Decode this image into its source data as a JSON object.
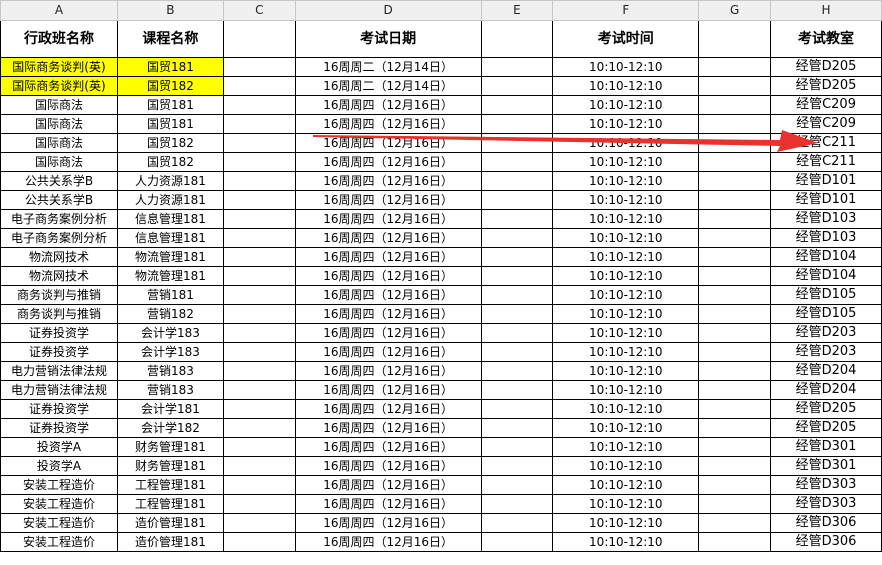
{
  "column_letters": [
    "A",
    "B",
    "C",
    "D",
    "E",
    "F",
    "G",
    "H"
  ],
  "headers": {
    "class": "行政班名称",
    "course": "课程名称",
    "c": "",
    "date": "考试日期",
    "e": "",
    "time": "考试时间",
    "g": "",
    "room": "考试教室"
  },
  "highlight_color": "#ffff00",
  "arrow": {
    "color": "#e8322d",
    "description_icon": "red-arrow-icon"
  },
  "rows": [
    {
      "a": "国际商务谈判(英)",
      "b": "国贸181",
      "d": "16周周二（12月14日）",
      "f": "10:10-12:10",
      "h": "经管D205",
      "highlight": true
    },
    {
      "a": "国际商务谈判(英)",
      "b": "国贸182",
      "d": "16周周二（12月14日）",
      "f": "10:10-12:10",
      "h": "经管D205",
      "highlight": true
    },
    {
      "a": "国际商法",
      "b": "国贸181",
      "d": "16周周四（12月16日）",
      "f": "10:10-12:10",
      "h": "经管C209"
    },
    {
      "a": "国际商法",
      "b": "国贸181",
      "d": "16周周四（12月16日）",
      "f": "10:10-12:10",
      "h": "经管C209"
    },
    {
      "a": "国际商法",
      "b": "国贸182",
      "d": "16周周四（12月16日）",
      "f": "10:10-12:10",
      "h": "经管C211"
    },
    {
      "a": "国际商法",
      "b": "国贸182",
      "d": "16周周四（12月16日）",
      "f": "10:10-12:10",
      "h": "经管C211"
    },
    {
      "a": "公共关系学B",
      "b": "人力资源181",
      "d": "16周周四（12月16日）",
      "f": "10:10-12:10",
      "h": "经管D101"
    },
    {
      "a": "公共关系学B",
      "b": "人力资源181",
      "d": "16周周四（12月16日）",
      "f": "10:10-12:10",
      "h": "经管D101"
    },
    {
      "a": "电子商务案例分析",
      "b": "信息管理181",
      "d": "16周周四（12月16日）",
      "f": "10:10-12:10",
      "h": "经管D103"
    },
    {
      "a": "电子商务案例分析",
      "b": "信息管理181",
      "d": "16周周四（12月16日）",
      "f": "10:10-12:10",
      "h": "经管D103"
    },
    {
      "a": "物流网技术",
      "b": "物流管理181",
      "d": "16周周四（12月16日）",
      "f": "10:10-12:10",
      "h": "经管D104"
    },
    {
      "a": "物流网技术",
      "b": "物流管理181",
      "d": "16周周四（12月16日）",
      "f": "10:10-12:10",
      "h": "经管D104"
    },
    {
      "a": "商务谈判与推销",
      "b": "营销181",
      "d": "16周周四（12月16日）",
      "f": "10:10-12:10",
      "h": "经管D105"
    },
    {
      "a": "商务谈判与推销",
      "b": "营销182",
      "d": "16周周四（12月16日）",
      "f": "10:10-12:10",
      "h": "经管D105"
    },
    {
      "a": "证券投资学",
      "b": "会计学183",
      "d": "16周周四（12月16日）",
      "f": "10:10-12:10",
      "h": "经管D203"
    },
    {
      "a": "证券投资学",
      "b": "会计学183",
      "d": "16周周四（12月16日）",
      "f": "10:10-12:10",
      "h": "经管D203"
    },
    {
      "a": "电力营销法律法规",
      "b": "营销183",
      "d": "16周周四（12月16日）",
      "f": "10:10-12:10",
      "h": "经管D204"
    },
    {
      "a": "电力营销法律法规",
      "b": "营销183",
      "d": "16周周四（12月16日）",
      "f": "10:10-12:10",
      "h": "经管D204"
    },
    {
      "a": "证券投资学",
      "b": "会计学181",
      "d": "16周周四（12月16日）",
      "f": "10:10-12:10",
      "h": "经管D205"
    },
    {
      "a": "证券投资学",
      "b": "会计学182",
      "d": "16周周四（12月16日）",
      "f": "10:10-12:10",
      "h": "经管D205"
    },
    {
      "a": "投资学A",
      "b": "财务管理181",
      "d": "16周周四（12月16日）",
      "f": "10:10-12:10",
      "h": "经管D301"
    },
    {
      "a": "投资学A",
      "b": "财务管理181",
      "d": "16周周四（12月16日）",
      "f": "10:10-12:10",
      "h": "经管D301"
    },
    {
      "a": "安装工程造价",
      "b": "工程管理181",
      "d": "16周周四（12月16日）",
      "f": "10:10-12:10",
      "h": "经管D303"
    },
    {
      "a": "安装工程造价",
      "b": "工程管理181",
      "d": "16周周四（12月16日）",
      "f": "10:10-12:10",
      "h": "经管D303"
    },
    {
      "a": "安装工程造价",
      "b": "造价管理181",
      "d": "16周周四（12月16日）",
      "f": "10:10-12:10",
      "h": "经管D306"
    },
    {
      "a": "安装工程造价",
      "b": "造价管理181",
      "d": "16周周四（12月16日）",
      "f": "10:10-12:10",
      "h": "经管D306"
    }
  ]
}
